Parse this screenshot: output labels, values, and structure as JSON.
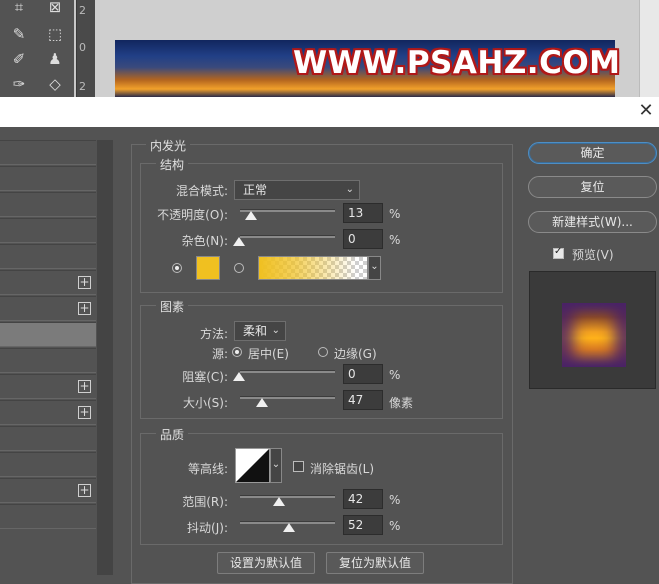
{
  "workspace": {
    "banner_text": "WWW.PSAHZ.COM",
    "ruler_numbers": [
      "2",
      "0",
      "2"
    ],
    "tools": [
      "crop-icon",
      "frame-icon",
      "eyedropper-icon",
      "marquee-icon",
      "brush-icon",
      "stamp-icon",
      "healing-icon",
      "eraser-icon"
    ]
  },
  "dialog": {
    "section_title": "内发光",
    "structure": {
      "title": "结构",
      "blend_mode_label": "混合模式:",
      "blend_mode_value": "正常",
      "opacity_label": "不透明度(O):",
      "opacity_value": "13",
      "opacity_unit": "%",
      "opacity_level": 13,
      "noise_label": "杂色(N):",
      "noise_value": "0",
      "noise_unit": "%",
      "noise_level": 0,
      "glow_color": "#f0c020"
    },
    "elements": {
      "title": "图素",
      "method_label": "方法:",
      "method_value": "柔和",
      "source_label": "源:",
      "source_center": "居中(E)",
      "source_edge": "边缘(G)",
      "choke_label": "阻塞(C):",
      "choke_value": "0",
      "choke_unit": "%",
      "size_label": "大小(S):",
      "size_value": "47",
      "size_unit": "像素"
    },
    "quality": {
      "title": "品质",
      "contour_label": "等高线:",
      "antialias_label": "消除锯齿(L)",
      "range_label": "范围(R):",
      "range_value": "42",
      "range_unit": "%",
      "jitter_label": "抖动(J):",
      "jitter_value": "52",
      "jitter_unit": "%"
    },
    "buttons": {
      "make_default": "设置为默认值",
      "reset_default": "复位为默认值",
      "ok": "确定",
      "reset": "复位",
      "new_style": "新建样式(W)...",
      "preview": "预览(V)"
    }
  }
}
